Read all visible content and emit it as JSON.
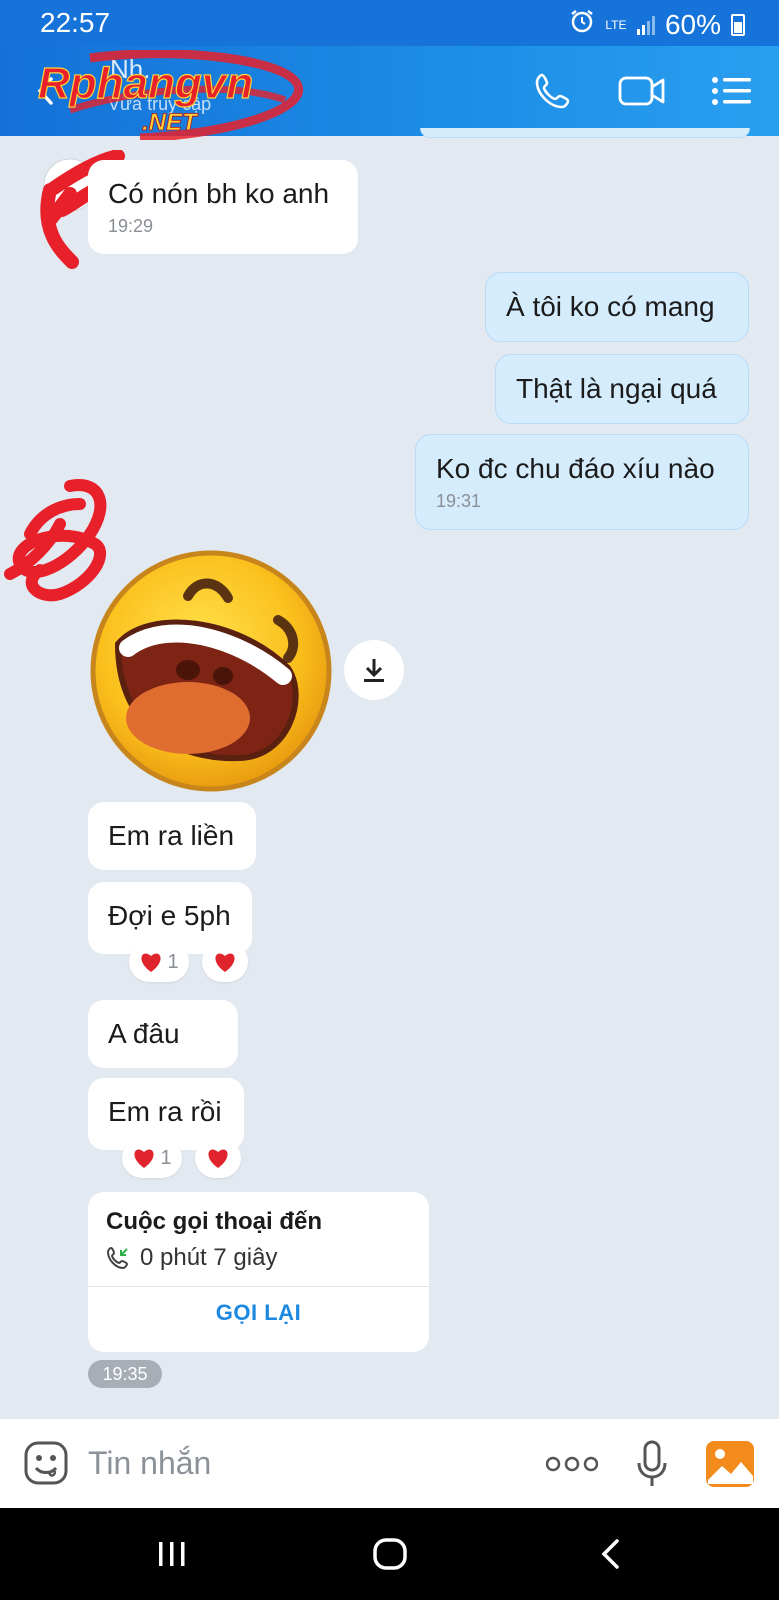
{
  "status_bar": {
    "time": "22:57",
    "network": "LTE",
    "battery": "60%"
  },
  "header": {
    "contact_name": "Nh...",
    "contact_status": "Vừa truy cập",
    "watermark_text": "Rphangvn .NET",
    "icons": [
      "back-icon",
      "phone-icon",
      "video-icon",
      "menu-icon"
    ]
  },
  "messages": [
    {
      "id": "m1",
      "direction": "received",
      "text": "Có nón bh ko anh",
      "time": "19:29"
    },
    {
      "id": "m2",
      "direction": "sent",
      "text": "À tôi ko có mang",
      "time": ""
    },
    {
      "id": "m3",
      "direction": "sent",
      "text": "Thật là ngại quá",
      "time": ""
    },
    {
      "id": "m4",
      "direction": "sent",
      "text": "Ko đc chu đáo xíu nào",
      "time": "19:31"
    },
    {
      "id": "m5",
      "direction": "received",
      "type": "sticker",
      "sticker": "laughing-face"
    },
    {
      "id": "m6",
      "direction": "received",
      "text": "Em ra liền",
      "time": ""
    },
    {
      "id": "m7",
      "direction": "received",
      "text": "Đợi e 5ph",
      "time": "",
      "reactions": {
        "heart_count": "1"
      }
    },
    {
      "id": "m8",
      "direction": "received",
      "text": "A đâu",
      "time": ""
    },
    {
      "id": "m9",
      "direction": "received",
      "text": "Em ra rồi",
      "time": "",
      "reactions": {
        "heart_count": "1"
      }
    }
  ],
  "call_card": {
    "title": "Cuộc gọi thoại đến",
    "duration": "0 phút 7 giây",
    "action": "GỌI LẠI",
    "time": "19:35"
  },
  "input": {
    "placeholder": "Tin nhắn"
  },
  "colors": {
    "header": "#1b86e3",
    "sent_bubble": "#d5ecfd",
    "received_bubble": "#ffffff",
    "background": "#e2e9f1",
    "accent": "#1c88df",
    "reaction_heart": "#e0242d"
  }
}
